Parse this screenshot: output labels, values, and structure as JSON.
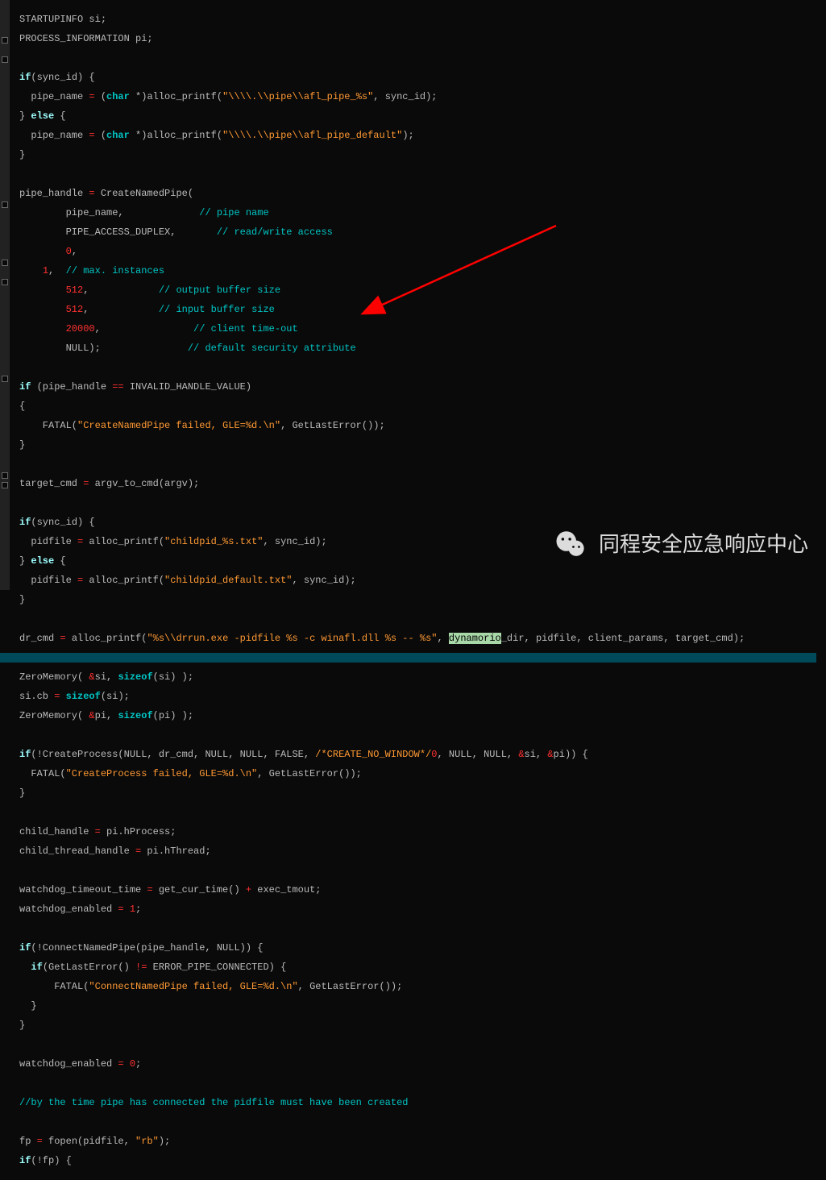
{
  "watermark_text": "同程安全应急响应中心",
  "highlighted_word": "dynamorio",
  "arrow": {
    "color": "#ff0000"
  },
  "code": {
    "l01a": "STARTUPINFO si;",
    "l01b": "PROCESS_INFORMATION pi;",
    "l02_if": "if",
    "l02_a": "(sync_id) {",
    "l03_a": "  pipe_name ",
    "l03_eq": "=",
    "l03_b": " (",
    "l03_char": "char",
    "l03_c": " *)alloc_printf(",
    "l03_s": "\"\\\\\\\\.\\\\pipe\\\\afl_pipe_%s\"",
    "l03_d": ", sync_id);",
    "l04_else": "else",
    "l04_a": " {",
    "l05_a": "  pipe_name ",
    "l05_eq": "=",
    "l05_b": " (",
    "l05_char": "char",
    "l05_c": " *)alloc_printf(",
    "l05_s": "\"\\\\\\\\.\\\\pipe\\\\afl_pipe_default\"",
    "l05_d": ");",
    "l06": "}",
    "l08_a": "pipe_handle ",
    "l08_eq": "=",
    "l08_b": " CreateNamedPipe(",
    "l09_a": "        pipe_name,             ",
    "l09_c": "// pipe name",
    "l10_a": "        PIPE_ACCESS_DUPLEX,       ",
    "l10_c": "// read/write access",
    "l11_a": "        ",
    "l11_n": "0",
    "l11_b": ",",
    "l12_a": "    ",
    "l12_n": "1",
    "l12_b": ",  ",
    "l12_c": "// max. instances",
    "l13_a": "        ",
    "l13_n": "512",
    "l13_b": ",            ",
    "l13_c": "// output buffer size",
    "l14_a": "        ",
    "l14_n": "512",
    "l14_b": ",            ",
    "l14_c": "// input buffer size",
    "l15_a": "        ",
    "l15_n": "20000",
    "l15_b": ",                ",
    "l15_c": "// client time-out",
    "l16_a": "        NULL);               ",
    "l16_c": "// default security attribute",
    "l18_if": "if",
    "l18_a": " (pipe_handle ",
    "l18_eq": "==",
    "l18_b": " INVALID_HANDLE_VALUE)",
    "l19": "{",
    "l20_a": "    FATAL(",
    "l20_s": "\"CreateNamedPipe failed, GLE=%d.\\n\"",
    "l20_b": ", GetLastError());",
    "l21": "}",
    "l23_a": "target_cmd ",
    "l23_eq": "=",
    "l23_b": " argv_to_cmd(argv);",
    "l25_if": "if",
    "l25_a": "(sync_id) {",
    "l26_a": "  pidfile ",
    "l26_eq": "=",
    "l26_b": " alloc_printf(",
    "l26_s": "\"childpid_%s.txt\"",
    "l26_c": ", sync_id);",
    "l27_else": "else",
    "l27_a": " {",
    "l28_a": "  pidfile ",
    "l28_eq": "=",
    "l28_b": " alloc_printf(",
    "l28_s": "\"childpid_default.txt\"",
    "l28_c": ", sync_id);",
    "l29": "}",
    "l31_a": "dr_cmd ",
    "l31_eq": "=",
    "l31_b": " alloc_printf(",
    "l31_s": "\"%s\\\\drrun.exe -pidfile %s -c winafl.dll %s -- %s\"",
    "l31_c": ", ",
    "l31_d": "_dir, pidfile, client_params, target_cmd);",
    "l33_a": "ZeroMemory( ",
    "l33_amp1": "&",
    "l33_b": "si, ",
    "l33_sz": "sizeof",
    "l33_c": "(si) );",
    "l34_a": "si.cb ",
    "l34_eq": "=",
    "l34_b": " ",
    "l34_sz": "sizeof",
    "l34_c": "(si);",
    "l35_a": "ZeroMemory( ",
    "l35_amp1": "&",
    "l35_b": "pi, ",
    "l35_sz": "sizeof",
    "l35_c": "(pi) );",
    "l37_if": "if",
    "l37_a": "(!CreateProcess(NULL, dr_cmd, NULL, NULL, FALSE, ",
    "l37_s": "/*CREATE_NO_WINDOW*/",
    "l37_n": "0",
    "l37_b": ", NULL, NULL, ",
    "l37_amp1": "&",
    "l37_c": "si, ",
    "l37_amp2": "&",
    "l37_d": "pi)) {",
    "l38_a": "  FATAL(",
    "l38_s": "\"CreateProcess failed, GLE=%d.\\n\"",
    "l38_b": ", GetLastError());",
    "l39": "}",
    "l41_a": "child_handle ",
    "l41_eq": "=",
    "l41_b": " pi.hProcess;",
    "l42_a": "child_thread_handle ",
    "l42_eq": "=",
    "l42_b": " pi.hThread;",
    "l44_a": "watchdog_timeout_time ",
    "l44_eq": "=",
    "l44_b": " get_cur_time() ",
    "l44_plus": "+",
    "l44_c": " exec_tmout;",
    "l45_a": "watchdog_enabled ",
    "l45_eq": "=",
    "l45_b": " ",
    "l45_n": "1",
    "l45_c": ";",
    "l47_if": "if",
    "l47_a": "(!ConnectNamedPipe(pipe_handle, NULL)) {",
    "l48_if": "if",
    "l48_a": "(GetLastError() ",
    "l48_ne": "!=",
    "l48_b": " ERROR_PIPE_CONNECTED) {",
    "l49_a": "      FATAL(",
    "l49_s": "\"ConnectNamedPipe failed, GLE=%d.\\n\"",
    "l49_b": ", GetLastError());",
    "l50": "  }",
    "l51": "}",
    "l53_a": "watchdog_enabled ",
    "l53_eq": "=",
    "l53_b": " ",
    "l53_n": "0",
    "l53_c": ";",
    "l55": "//by the time pipe has connected the pidfile must have been created",
    "l57_a": "fp ",
    "l57_eq": "=",
    "l57_b": " fopen(pidfile, ",
    "l57_s": "\"rb\"",
    "l57_c": ");",
    "l58_if": "if",
    "l58_a": "(!fp) {"
  }
}
